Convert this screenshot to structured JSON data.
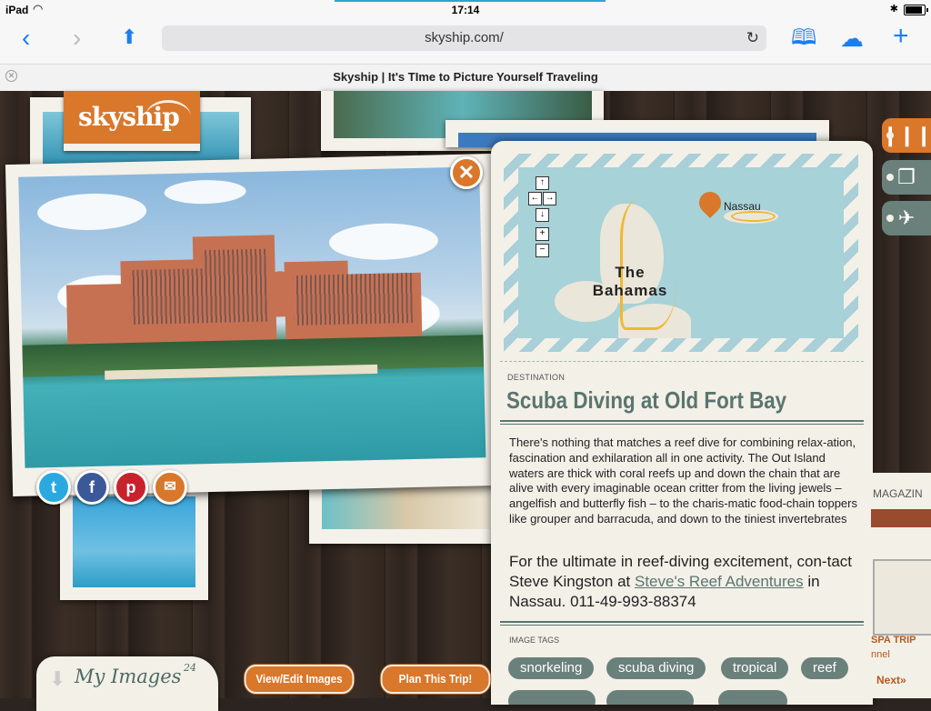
{
  "status_bar": {
    "device": "iPad",
    "time": "17:14"
  },
  "browser": {
    "url": "skyship.com/",
    "tab_title": "Skyship | It's TIme to Picture Yourself Traveling"
  },
  "site": {
    "logo_text": "skyship"
  },
  "card": {
    "map": {
      "place_primary": "Nassau",
      "place_secondary": "The Bahamas"
    },
    "dest_label": "DESTINATION",
    "title": "Scuba Diving at Old Fort Bay",
    "body1": "There's nothing that matches a reef dive for combining relax-ation, fascination and exhilaration all in one activity. The Out Island waters are thick with coral reefs up and down the chain that are alive with every imaginable ocean critter from the living jewels – angelfish and butterfly fish – to the charis-matic food-chain toppers like grouper and barracuda, and down to the tiniest invertebrates",
    "body2_before": "For the ultimate in reef-diving excitement, con-tact Steve Kingston at ",
    "body2_link": "Steve's Reef Adventures",
    "body2_after": " in Nassau. 011-49-993-88374",
    "tags_label": "IMAGE TAGS",
    "tags": [
      "snorkeling",
      "scuba diving",
      "tropical",
      "reef"
    ]
  },
  "bottom": {
    "my_images_label": "My Images",
    "my_images_count": "24",
    "edit_button": "View/Edit Images",
    "plan_button": "Plan This Trip!"
  },
  "right_panel": {
    "magazine_text": "MAGAZIN",
    "spa_text": "SPA TRIP",
    "spa_sub": "nnel",
    "next_text": "Next»"
  },
  "colors": {
    "accent_orange": "#d9772b",
    "slate_green": "#6a807b",
    "ios_blue": "#1a7ef0"
  }
}
